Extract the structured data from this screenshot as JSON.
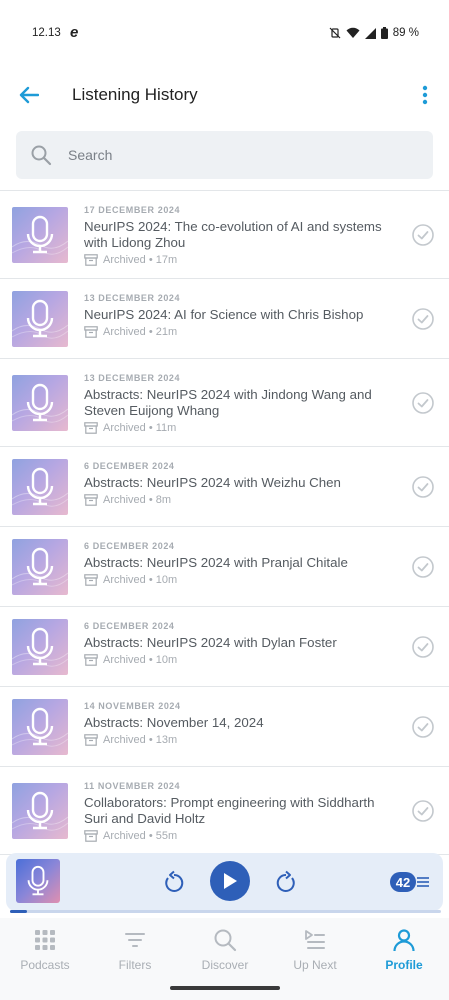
{
  "status_bar": {
    "time": "12.13",
    "app_letter": "e",
    "battery": "89 %"
  },
  "header": {
    "title": "Listening History"
  },
  "search": {
    "placeholder": "Search"
  },
  "episodes": [
    {
      "date": "17 DECEMBER 2024",
      "title": "NeurIPS 2024: The co-evolution of AI and systems with Lidong Zhou",
      "meta": "Archived • 17m"
    },
    {
      "date": "13 DECEMBER 2024",
      "title": "NeurIPS 2024: AI for Science with Chris Bishop",
      "meta": "Archived • 21m"
    },
    {
      "date": "13 DECEMBER 2024",
      "title": "Abstracts: NeurIPS 2024 with Jindong Wang and Steven Euijong Whang",
      "meta": "Archived • 11m"
    },
    {
      "date": "6 DECEMBER 2024",
      "title": "Abstracts: NeurIPS 2024 with Weizhu Chen",
      "meta": "Archived • 8m"
    },
    {
      "date": "6 DECEMBER 2024",
      "title": "Abstracts: NeurIPS 2024 with Pranjal Chitale",
      "meta": "Archived • 10m"
    },
    {
      "date": "6 DECEMBER 2024",
      "title": "Abstracts: NeurIPS 2024 with Dylan Foster",
      "meta": "Archived • 10m"
    },
    {
      "date": "14 NOVEMBER 2024",
      "title": "Abstracts: November 14, 2024",
      "meta": "Archived • 13m"
    },
    {
      "date": "11 NOVEMBER 2024",
      "title": "Collaborators: Prompt engineering with Siddharth Suri and David Holtz",
      "meta": "Archived • 55m"
    }
  ],
  "player": {
    "queue_count": "42",
    "progress": 0.04
  },
  "nav": [
    {
      "label": "Podcasts",
      "icon": "grid-icon"
    },
    {
      "label": "Filters",
      "icon": "filter-icon"
    },
    {
      "label": "Discover",
      "icon": "search-icon"
    },
    {
      "label": "Up Next",
      "icon": "queue-icon"
    },
    {
      "label": "Profile",
      "icon": "person-icon"
    }
  ],
  "colors": {
    "accent": "#1e9bd7",
    "player_blue": "#2e5fb8"
  }
}
